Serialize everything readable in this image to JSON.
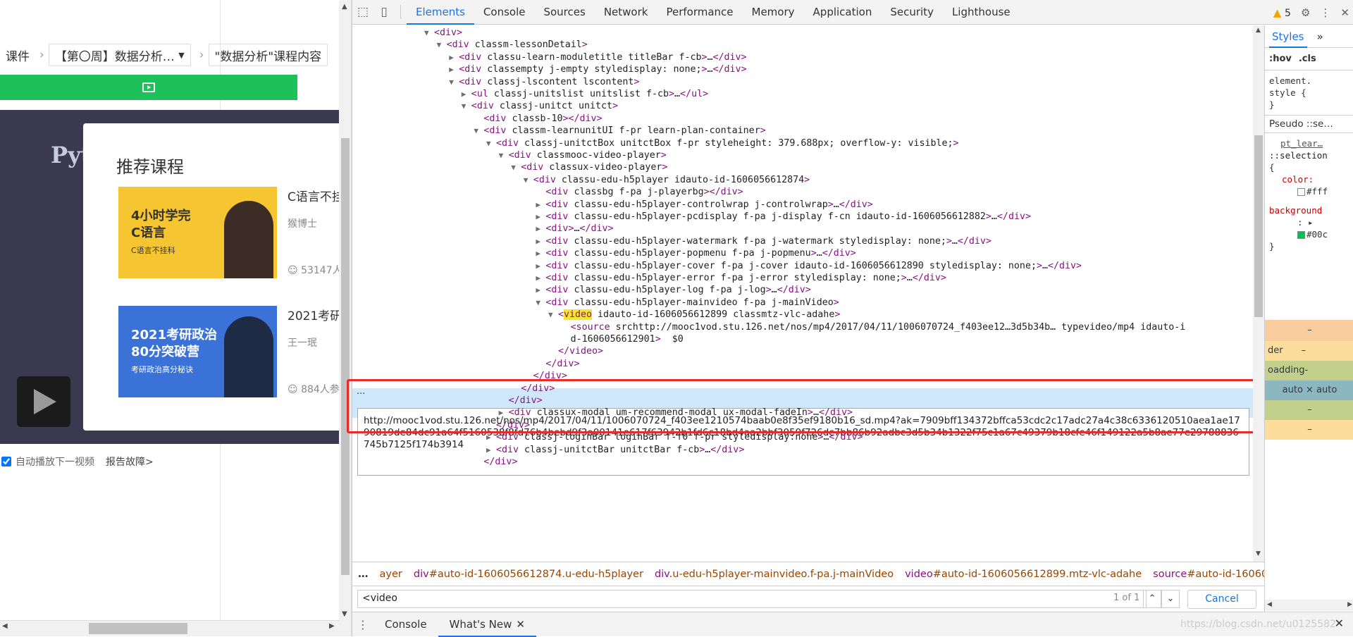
{
  "left": {
    "breadcrumb": {
      "item1": "课件",
      "item2": "【第〇周】数据分析…",
      "item3": "\"数据分析\"课程内容"
    },
    "video_overlay_text": "Pyt",
    "recommend": {
      "title": "推荐课程",
      "courses": [
        {
          "name": "C语言不挂",
          "teacher": "猴博士",
          "count": "53147人",
          "img_caption": "4小时学完\nC语言",
          "img_sub": "C语言不挂科",
          "bg": "#f6c532"
        },
        {
          "name": "2021考研",
          "teacher": "王一珉",
          "count": "884人参",
          "img_caption": "2021考研政治\n80分突破营",
          "img_sub": "考研政治高分秘诀",
          "bg": "#3a72d8"
        }
      ]
    },
    "autoplay_label": "自动播放下一视频",
    "report_label": "报告故障>"
  },
  "devtools": {
    "tabs": [
      "Elements",
      "Console",
      "Sources",
      "Network",
      "Performance",
      "Memory",
      "Application",
      "Security",
      "Lighthouse"
    ],
    "active_tab": "Elements",
    "warning_count": "5",
    "dom_lines": [
      {
        "indent": 0,
        "t": "▼",
        "h": "<div>"
      },
      {
        "indent": 1,
        "t": "▼",
        "h": "<div class=\"m-lessonDetail\">"
      },
      {
        "indent": 2,
        "t": "▶",
        "h": "<div class=\"u-learn-moduletitle titleBar f-cb\">…</div>"
      },
      {
        "indent": 2,
        "t": "▶",
        "h": "<div class=\"empty j-empty\" style=\"display: none;\">…</div>"
      },
      {
        "indent": 2,
        "t": "▼",
        "h": "<div class=\"j-lscontent lscontent\">"
      },
      {
        "indent": 3,
        "t": "▶",
        "h": "<ul class=\"j-unitslist unitslist f-cb\">…</ul>"
      },
      {
        "indent": 3,
        "t": "▼",
        "h": "<div class=\"j-unitct unitct\">"
      },
      {
        "indent": 4,
        "t": "",
        "h": "<div class=\"b-10\"></div>"
      },
      {
        "indent": 4,
        "t": "▼",
        "h": "<div class=\"m-learnunitUI f-pr learn-plan-container\">"
      },
      {
        "indent": 5,
        "t": "▼",
        "h": "<div class=\"j-unitctBox unitctBox f-pr\" style=\"height: 379.688px; overflow-y: visible;\">"
      },
      {
        "indent": 6,
        "t": "▼",
        "h": "<div class=\"mooc-video-player\">"
      },
      {
        "indent": 7,
        "t": "▼",
        "h": "<div class=\"ux-video-player\">"
      },
      {
        "indent": 8,
        "t": "▼",
        "h": "<div class=\"u-edu-h5player\" id=\"auto-id-1606056612874\">"
      },
      {
        "indent": 9,
        "t": "",
        "h": "<div class=\"bg f-pa j-playerbg\"></div>"
      },
      {
        "indent": 9,
        "t": "▶",
        "h": "<div class=\"u-edu-h5player-controlwrap j-controlwrap\">…</div>"
      },
      {
        "indent": 9,
        "t": "▶",
        "h": "<div class=\"u-edu-h5player-pcdisplay f-pa j-display f-cn\" id=\"auto-id-1606056612882\">…</div>"
      },
      {
        "indent": 9,
        "t": "▶",
        "h": "<div>…</div>"
      },
      {
        "indent": 9,
        "t": "▶",
        "h": "<div class=\"u-edu-h5player-watermark f-pa j-watermark\" style=\"display: none;\">…</div>"
      },
      {
        "indent": 9,
        "t": "▶",
        "h": "<div class=\"u-edu-h5player-popmenu f-pa j-popmenu\">…</div>"
      },
      {
        "indent": 9,
        "t": "▶",
        "h": "<div class=\"u-edu-h5player-cover f-pa j-cover\" id=\"auto-id-1606056612890\" style=\"display: none;\">…</div>"
      },
      {
        "indent": 9,
        "t": "▶",
        "h": "<div class=\"u-edu-h5player-error f-pa j-error\" style=\"display: none;\">…</div>"
      },
      {
        "indent": 9,
        "t": "▶",
        "h": "<div class=\"u-edu-h5player-log f-pa j-log\">…</div>"
      },
      {
        "indent": 9,
        "t": "▼",
        "h": "<div class=\"u-edu-h5player-mainvideo f-pa j-mainVideo\">"
      },
      {
        "indent": 10,
        "t": "▼",
        "h": "<video id=\"auto-id-1606056612899\" class=\"mtz-vlc-adahe\">"
      },
      {
        "indent": 11,
        "t": "",
        "h": "<source src=\"http://mooc1vod.stu.126.net/nos/mp4/2017/04/11/1006070724_f403ee12…3d5b34b…\" type=\"video/mp4\" id=\"auto-i"
      },
      {
        "indent": 11,
        "t": "",
        "h": "d-1606056612901\"> == $0"
      },
      {
        "indent": 10,
        "t": "",
        "h": "</video>"
      },
      {
        "indent": 9,
        "t": "",
        "h": "</div>"
      },
      {
        "indent": 8,
        "t": "",
        "h": "</div>"
      },
      {
        "indent": 7,
        "t": "",
        "h": "</div>"
      },
      {
        "indent": 6,
        "t": "",
        "h": "</div>"
      },
      {
        "indent": 6,
        "t": "▶",
        "h": "<div class=\"ux-modal um-recommend-modal ux-modal-fadeIn\">…</div>"
      },
      {
        "indent": 5,
        "t": "",
        "h": "</div>"
      },
      {
        "indent": 5,
        "t": "▶",
        "h": "<div class=\"j-loginBar loginBar f-f0 f-pr\" style=\"display:none\">…</div>"
      },
      {
        "indent": 5,
        "t": "▶",
        "h": "<div class=\"j-unitctBar unitctBar f-cb\">…</div>"
      },
      {
        "indent": 4,
        "t": "",
        "h": "</div>"
      }
    ],
    "tooltip": "http://mooc1vod.stu.126.net/nos/mp4/2017/04/11/1006070724_f403ee1210574baab0e8f35ef9180b16_sd.mp4?ak=7909bff134372bffca53cdc2c17adc27a4c38c6336120510aea1ae1790819de84dc91a64f5160538f8fd76b4bebd9f3a00141e617f63942b1fd6c18bd4aa2bbf3059f726dc7bb86b92adbc3d5b34b1322f75c1a67c49379b18cfe46f149122a5b8ae77e29788836745b7125f174b3914",
    "crumbs": [
      {
        "tag": "",
        "attr": "ayer"
      },
      {
        "tag": "div",
        "attr": "#auto-id-1606056612874.u-edu-h5player"
      },
      {
        "tag": "div",
        "attr": ".u-edu-h5player-mainvideo.f-pa.j-mainVideo"
      },
      {
        "tag": "video",
        "attr": "#auto-id-1606056612899.mtz-vlc-adahe"
      },
      {
        "tag": "source",
        "attr": "#auto-id-1606056612901"
      }
    ],
    "search": {
      "value": "<video",
      "count": "1 of 1",
      "cancel": "Cancel"
    },
    "drawer": {
      "tab1": "Console",
      "tab2": "What's New",
      "watermark": "https://blog.csdn.net/u0125582"
    },
    "styles": {
      "tab": "Styles",
      "hov": ":hov",
      "cls": ".cls",
      "rule1": "element.\nstyle {\n}",
      "pseudo": "Pseudo ::se…",
      "pt": "pt_lear…",
      "sel2": "::selection",
      "color_prop": "color:",
      "color_val": "#fff",
      "bg_prop": "background",
      "bg_val": "#00c",
      "box_margin": "–",
      "box_border": "der",
      "box_border_val": "–",
      "box_padding": "oadding-",
      "box_content": "auto × auto",
      "box_pad2": "–",
      "box_marg2": "–"
    }
  }
}
